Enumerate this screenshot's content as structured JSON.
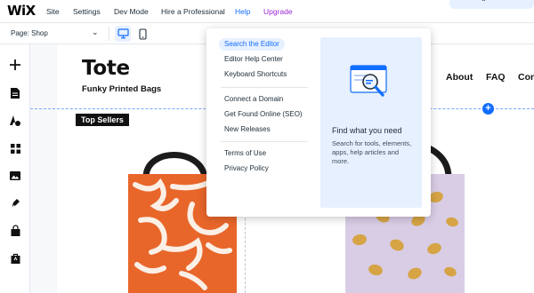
{
  "logo": "WiX",
  "menu": [
    {
      "label": "Site"
    },
    {
      "label": "Settings"
    },
    {
      "label": "Dev Mode"
    },
    {
      "label": "Hire a Professional"
    },
    {
      "label": "Help"
    },
    {
      "label": "Upgrade"
    }
  ],
  "page_selector": {
    "label": "Page: Shop"
  },
  "canvas": {
    "title": "Tote",
    "subtitle": "Funky Printed Bags",
    "nav": [
      "About",
      "FAQ",
      "Con"
    ],
    "badge": "Top Sellers"
  },
  "help_menu": {
    "groups": [
      [
        "Search the Editor",
        "Editor Help Center",
        "Keyboard Shortcuts"
      ],
      [
        "Connect a Domain",
        "Get Found Online (SEO)",
        "New Releases"
      ],
      [
        "Terms of Use",
        "Privacy Policy"
      ]
    ],
    "selected": "Search the Editor",
    "panel": {
      "title": "Find what you need",
      "description": "Search for tools, elements, apps, help articles and more."
    }
  },
  "colors": {
    "accent": "#116dff",
    "upgrade": "#9a27d5",
    "bag_orange": "#e8662a",
    "bag_lilac": "#d9cde6",
    "lemon": "#d6a445"
  }
}
